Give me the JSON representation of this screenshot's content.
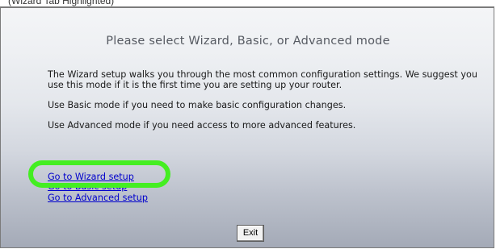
{
  "caption": "(Wizard Tab Highlighted)",
  "page": {
    "title": "Please select Wizard, Basic, or Advanced mode",
    "paragraphs": [
      "The Wizard setup walks you through the most common configuration settings. We suggest you use this mode if it is the first time you are setting up your router.",
      "Use Basic mode if you need to make basic configuration changes.",
      "Use Advanced mode if you need access to more advanced features."
    ]
  },
  "links": {
    "wizard": "Go to Wizard setup",
    "basic": "Go to Basic setup",
    "advanced": "Go to Advanced setup"
  },
  "buttons": {
    "exit": "Exit"
  },
  "colors": {
    "highlight": "#44ee22",
    "link": "#0000cc",
    "title": "#565a62"
  }
}
